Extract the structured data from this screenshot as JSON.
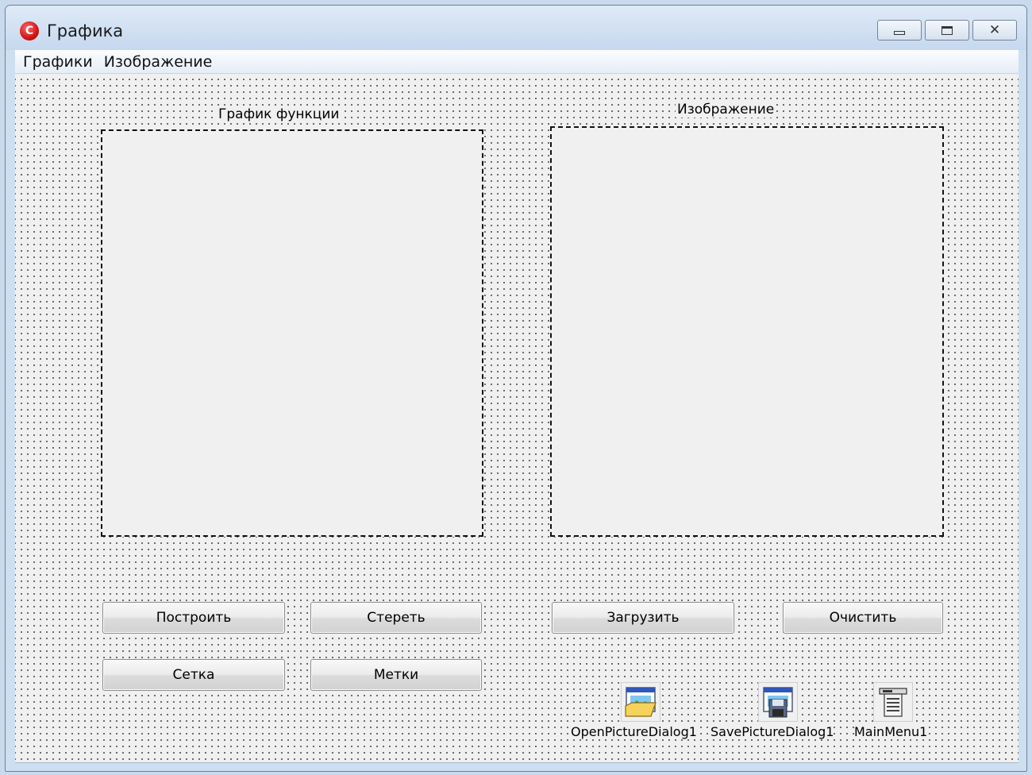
{
  "window": {
    "title": "Графика"
  },
  "menu": {
    "items": [
      "Графики",
      "Изображение"
    ]
  },
  "function_box": {
    "label": "График функции"
  },
  "image_box": {
    "label": "Изображение"
  },
  "buttons": {
    "build": "Построить",
    "erase": "Стереть",
    "grid": "Сетка",
    "marks": "Метки",
    "load": "Загрузить",
    "clear": "Очистить"
  },
  "components": {
    "open_dialog": "OpenPictureDialog1",
    "save_dialog": "SavePictureDialog1",
    "main_menu": "MainMenu1"
  },
  "colors": {
    "app_icon": "#d01414",
    "form_background": "#f0f0f0",
    "title_bar": "#cfdff2"
  },
  "icons": {
    "app": "cpp-builder-app-icon",
    "open_dialog": "open-picture-dialog-icon",
    "save_dialog": "save-picture-dialog-icon",
    "main_menu": "main-menu-icon"
  }
}
